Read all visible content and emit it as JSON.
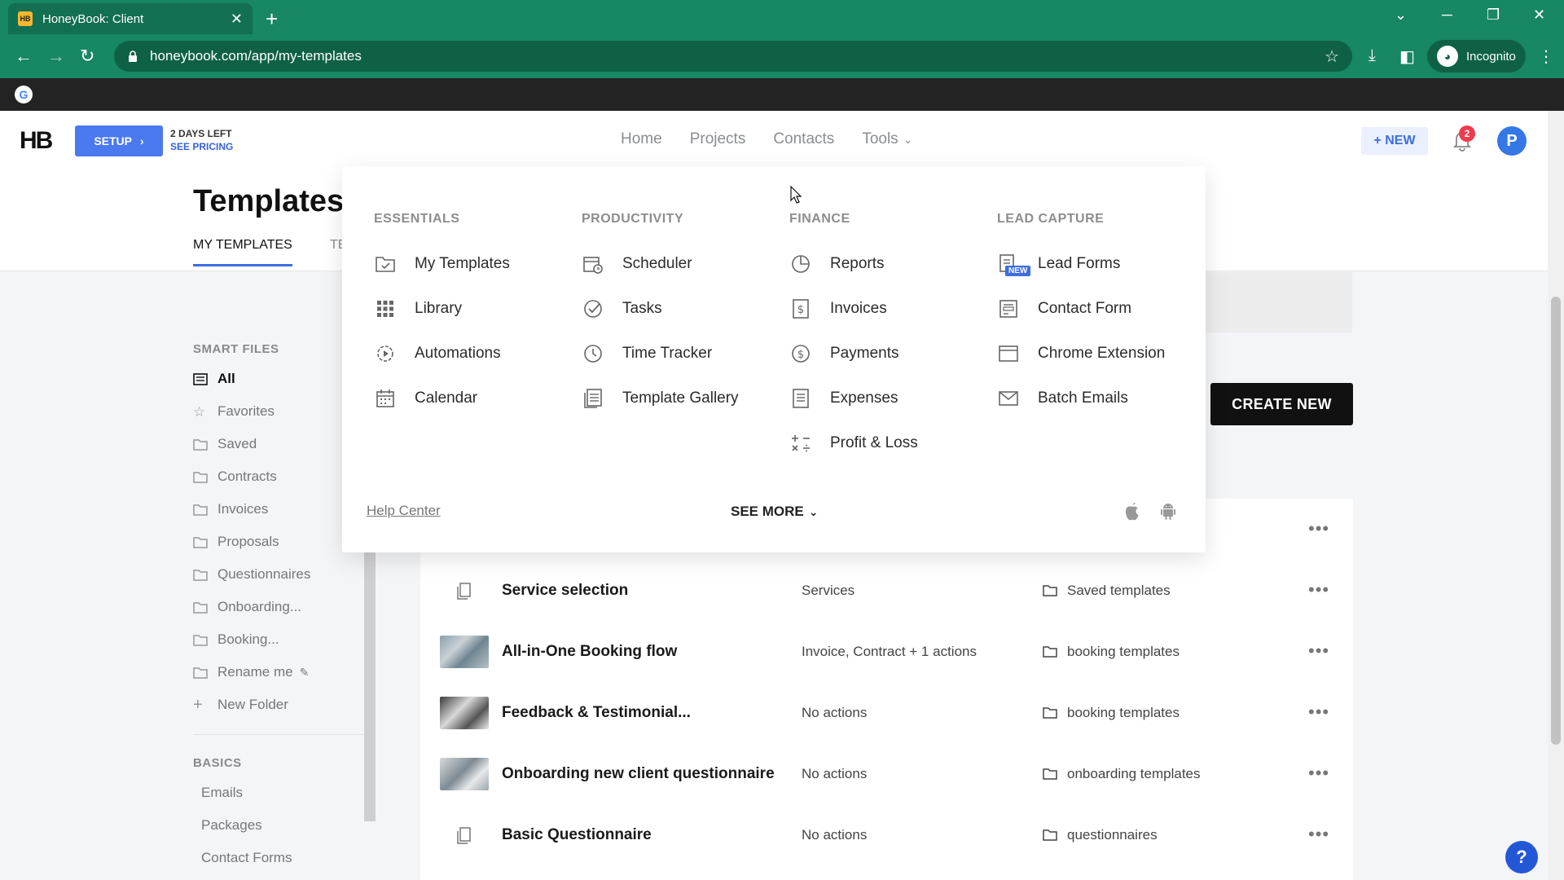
{
  "browser": {
    "tab_title": "HoneyBook: Client",
    "tab_favicon_text": "HB",
    "url": "honeybook.com/app/my-templates",
    "incognito_label": "Incognito",
    "google_letter": "G"
  },
  "header": {
    "logo": "HB",
    "setup_label": "SETUP",
    "trial_days": "2 DAYS LEFT",
    "see_pricing": "SEE PRICING",
    "nav": [
      "Home",
      "Projects",
      "Contacts",
      "Tools"
    ],
    "new_label": "+ NEW",
    "notification_count": "2",
    "avatar_letter": "P"
  },
  "page": {
    "title": "Templates",
    "tabs": [
      "MY TEMPLATES",
      "TE"
    ]
  },
  "sidebar": {
    "smart_files_heading": "SMART FILES",
    "items": [
      "All",
      "Favorites",
      "Saved",
      "Contracts",
      "Invoices",
      "Proposals",
      "Questionnaires",
      "Onboarding...",
      "Booking...",
      "Rename me",
      "New Folder"
    ],
    "basics_heading": "BASICS",
    "basics": [
      "Emails",
      "Packages",
      "Contact Forms"
    ]
  },
  "create_new_label": "CREATE NEW",
  "templates": [
    {
      "name": "Service selection",
      "actions": "Services",
      "folder": "Saved templates",
      "thumb": "doc"
    },
    {
      "name": "All-in-One Booking flow",
      "actions": "Invoice, Contract + 1 actions",
      "folder": "booking templates",
      "thumb": "photo"
    },
    {
      "name": "Feedback & Testimonial...",
      "actions": "No actions",
      "folder": "booking templates",
      "thumb": "photo"
    },
    {
      "name": "Onboarding new client questionnaire",
      "actions": "No actions",
      "folder": "onboarding templates",
      "thumb": "photo"
    },
    {
      "name": "Basic Questionnaire",
      "actions": "No actions",
      "folder": "questionnaires",
      "thumb": "doc"
    }
  ],
  "tools_menu": {
    "columns": [
      {
        "heading": "ESSENTIALS",
        "items": [
          "My Templates",
          "Library",
          "Automations",
          "Calendar"
        ]
      },
      {
        "heading": "PRODUCTIVITY",
        "items": [
          "Scheduler",
          "Tasks",
          "Time Tracker",
          "Template Gallery"
        ]
      },
      {
        "heading": "FINANCE",
        "items": [
          "Reports",
          "Invoices",
          "Payments",
          "Expenses",
          "Profit & Loss"
        ]
      },
      {
        "heading": "LEAD CAPTURE",
        "items": [
          "Lead Forms",
          "Contact Form",
          "Chrome Extension",
          "Batch Emails"
        ]
      }
    ],
    "new_tag": "NEW",
    "help_center": "Help Center",
    "see_more": "SEE MORE"
  },
  "help_fab": "?",
  "colors": {
    "browser_green": "#188763",
    "accent_blue": "#3d6de0",
    "create_new_bg": "#111111",
    "badge_red": "#ef3b4c"
  }
}
